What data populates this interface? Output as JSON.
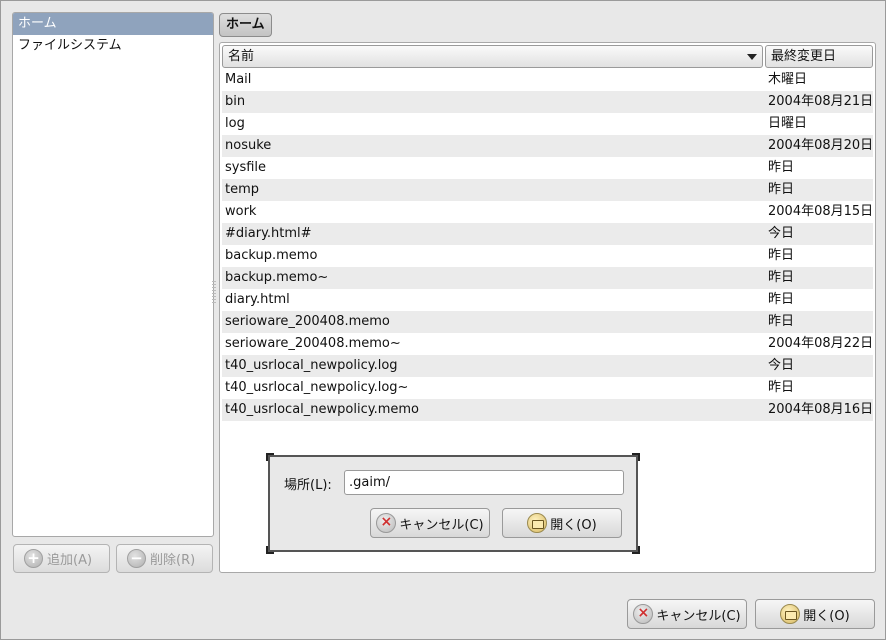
{
  "sidebar": {
    "places": [
      {
        "label": "ホーム",
        "selected": true
      },
      {
        "label": "ファイルシステム",
        "selected": false
      }
    ],
    "add_button": "追加(A)",
    "remove_button": "削除(R)"
  },
  "pathbar": {
    "current": "ホーム"
  },
  "filelist": {
    "columns": {
      "name": "名前",
      "modified": "最終変更日"
    },
    "sort": "descending",
    "rows": [
      {
        "name": "Mail",
        "modified": "木曜日"
      },
      {
        "name": "bin",
        "modified": "2004年08月21日"
      },
      {
        "name": "log",
        "modified": "日曜日"
      },
      {
        "name": "nosuke",
        "modified": "2004年08月20日"
      },
      {
        "name": "sysfile",
        "modified": "昨日"
      },
      {
        "name": "temp",
        "modified": "昨日"
      },
      {
        "name": "work",
        "modified": "2004年08月15日"
      },
      {
        "name": "#diary.html#",
        "modified": "今日"
      },
      {
        "name": "backup.memo",
        "modified": "昨日"
      },
      {
        "name": "backup.memo~",
        "modified": "昨日"
      },
      {
        "name": "diary.html",
        "modified": "昨日"
      },
      {
        "name": "serioware_200408.memo",
        "modified": "昨日"
      },
      {
        "name": "serioware_200408.memo~",
        "modified": "2004年08月22日"
      },
      {
        "name": "t40_usrlocal_newpolicy.log",
        "modified": "今日"
      },
      {
        "name": "t40_usrlocal_newpolicy.log~",
        "modified": "昨日"
      },
      {
        "name": "t40_usrlocal_newpolicy.memo",
        "modified": "2004年08月16日"
      }
    ]
  },
  "location_dialog": {
    "label": "場所(L):",
    "value": ".gaim/",
    "cancel": "キャンセル(C)",
    "open": "開く(O)"
  },
  "footer": {
    "cancel": "キャンセル(C)",
    "open": "開く(O)"
  },
  "colors": {
    "selection": "#8fa3bd",
    "cancel_icon": "#d03030"
  }
}
